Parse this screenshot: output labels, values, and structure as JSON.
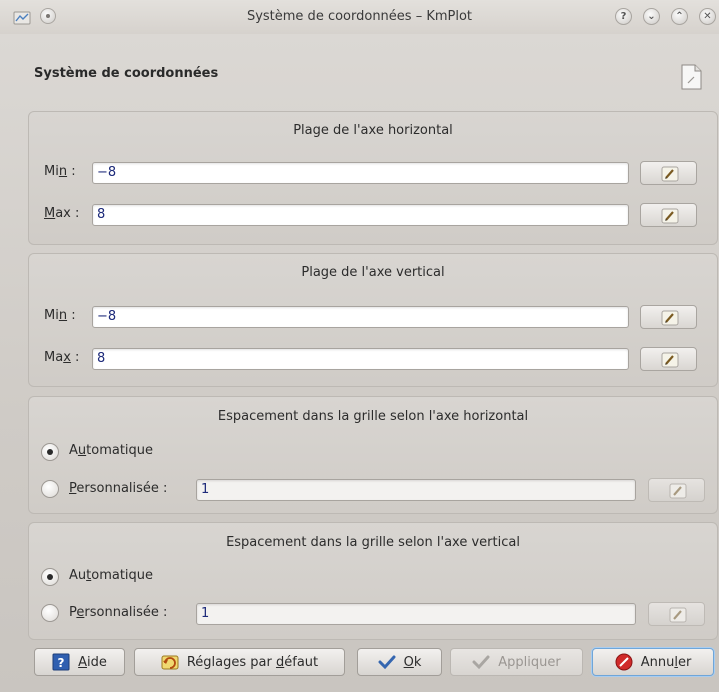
{
  "window": {
    "title": "Système de coordonnées – KmPlot",
    "buttons": {
      "help": "?",
      "minimize": "⌄",
      "maximize": "⌃",
      "close": "✕"
    }
  },
  "header": {
    "title": "Système de coordonnées",
    "icon": "document-icon"
  },
  "horizontal_range": {
    "title": "Plage de l'axe horizontal",
    "min_label": "Min :",
    "min_value": "−8",
    "max_label": "Max :",
    "max_value": "8"
  },
  "vertical_range": {
    "title": "Plage de l'axe vertical",
    "min_label": "Min :",
    "min_value": "−8",
    "max_label": "Max :",
    "max_value": "8"
  },
  "grid_horizontal": {
    "title": "Espacement dans la grille selon l'axe horizontal",
    "auto_label": "Automatique",
    "custom_label": "Personnalisée :",
    "custom_value": "1",
    "selected": "Automatique"
  },
  "grid_vertical": {
    "title": "Espacement dans la grille selon l'axe vertical",
    "auto_label": "Automatique",
    "custom_label": "Personnalisée :",
    "custom_value": "1",
    "selected": "Automatique"
  },
  "footer": {
    "help": "Aide",
    "defaults": "Réglages par défaut",
    "ok": "Ok",
    "apply": "Appliquer",
    "cancel": "Annuler"
  },
  "colors": {
    "field_text": "#1d2a7a",
    "focus": "#6fa6d9"
  }
}
